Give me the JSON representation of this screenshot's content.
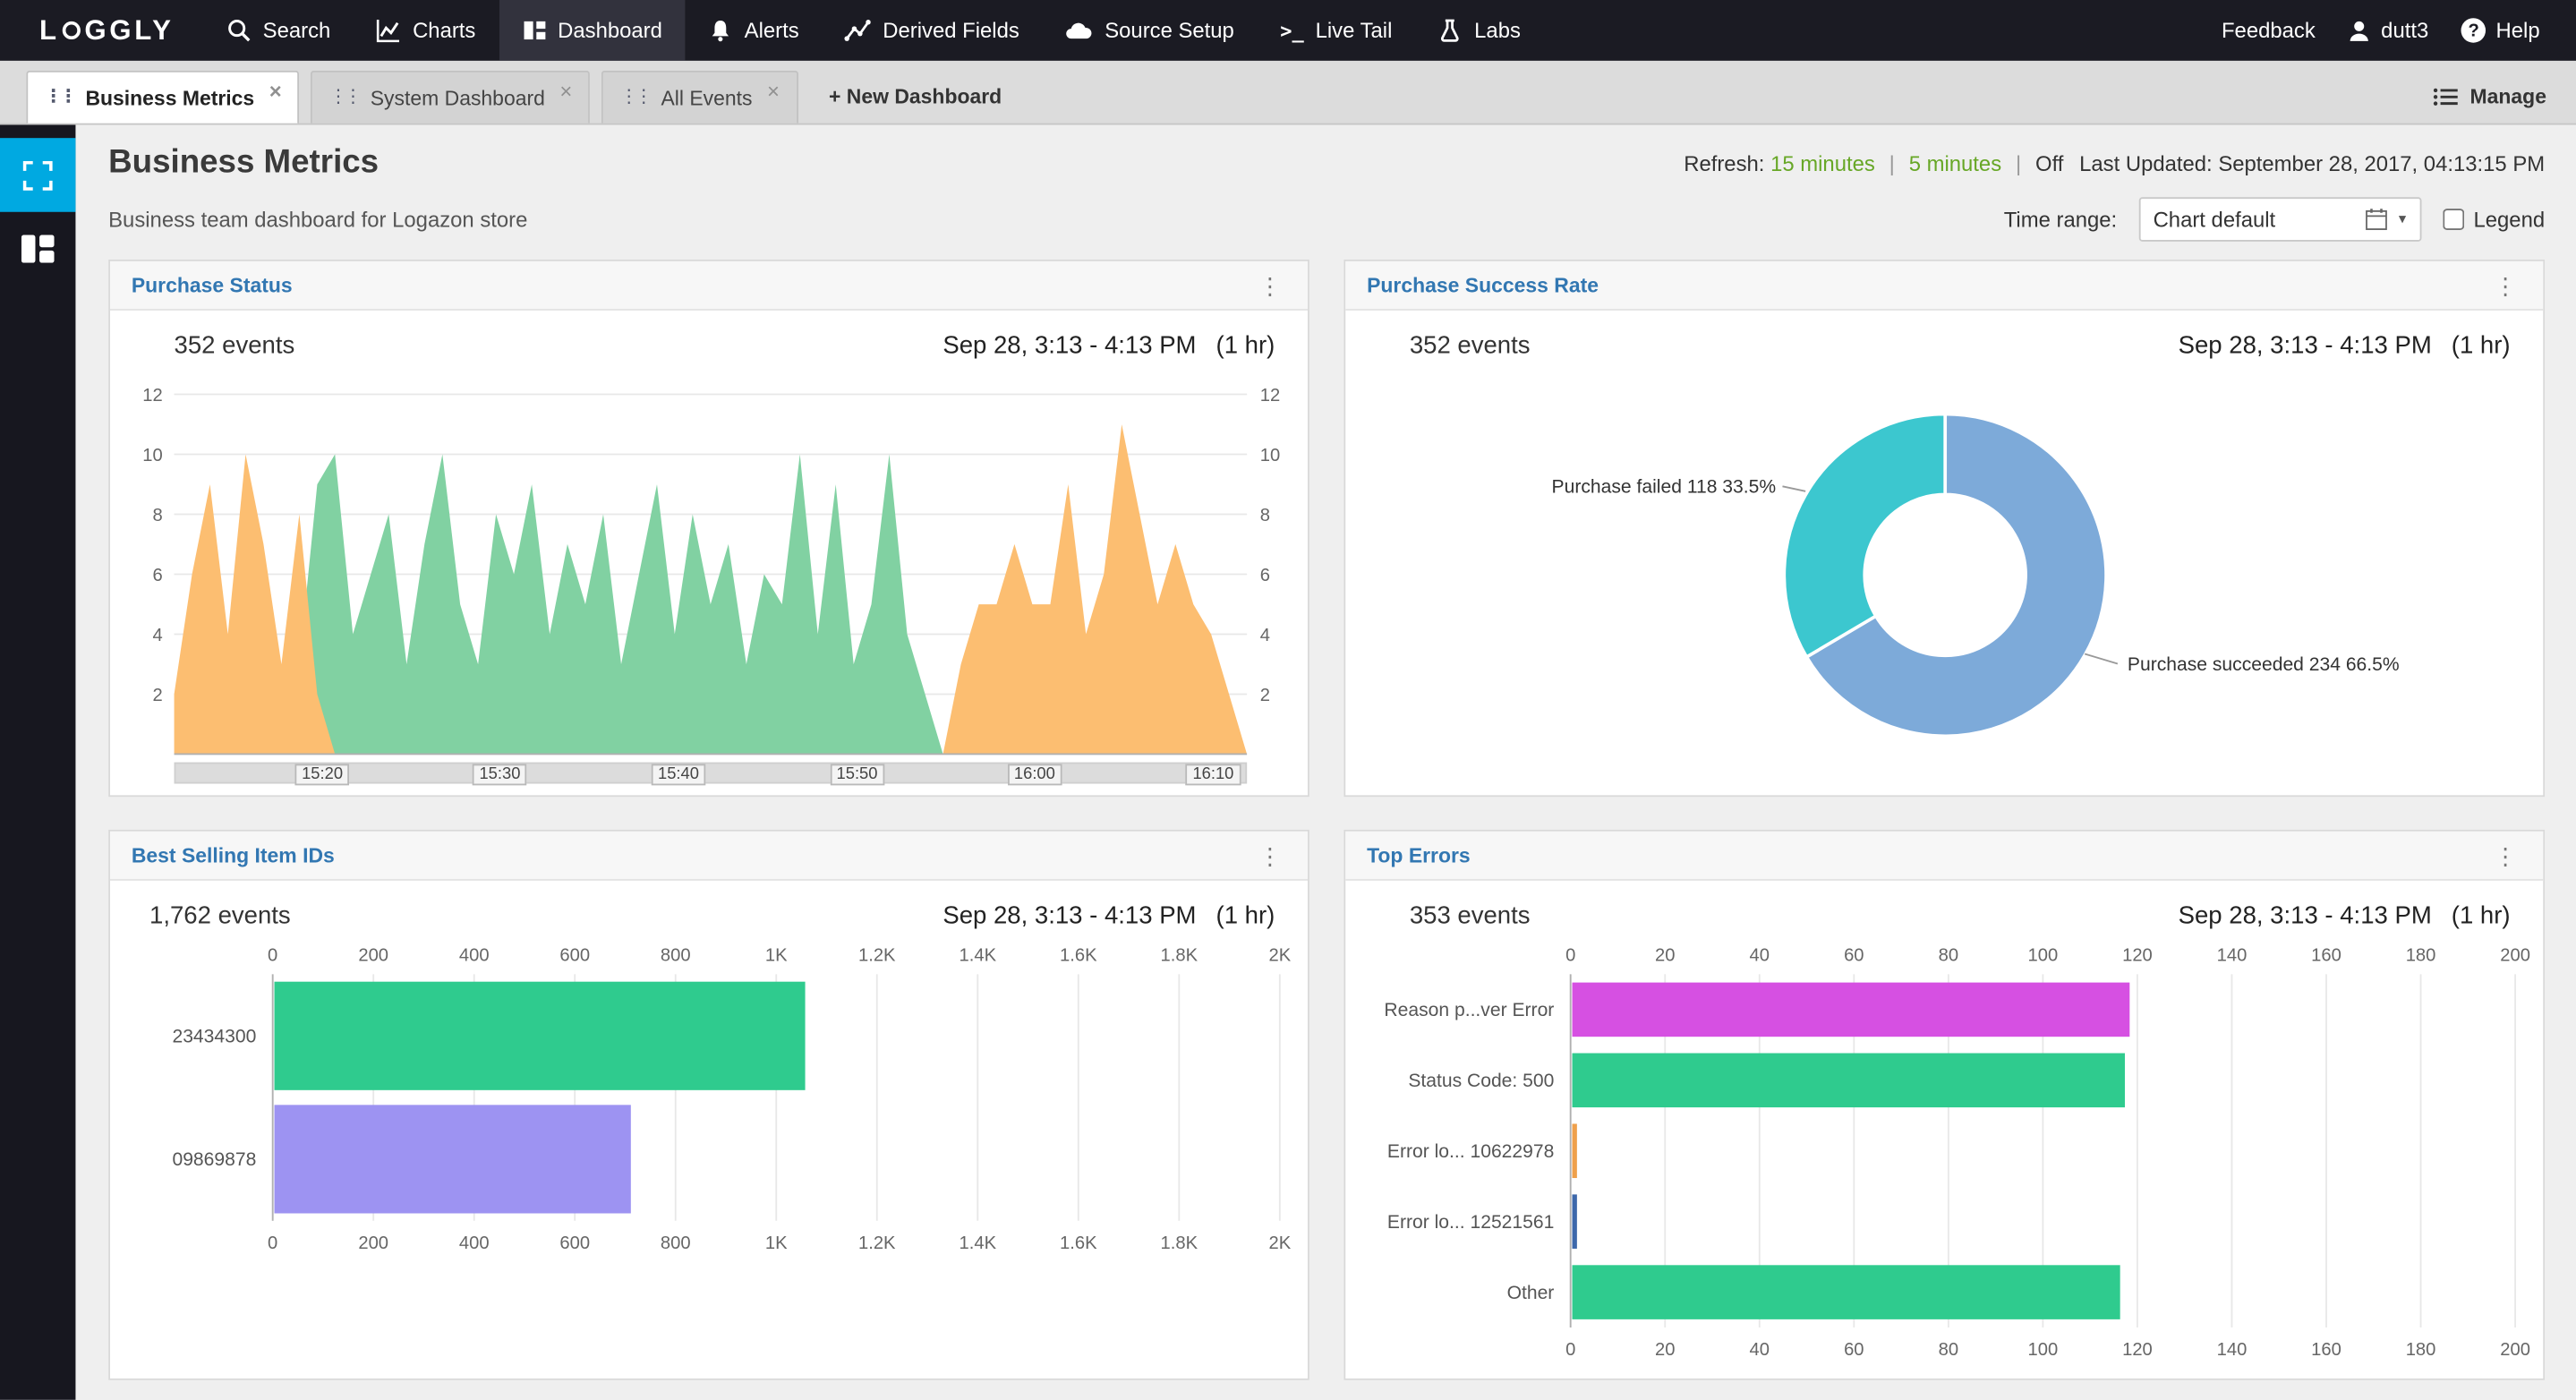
{
  "nav": {
    "logo": {
      "prefix": "L",
      "suffix": "GGLY",
      "full": "LOGGLY"
    },
    "items": [
      {
        "label": "Search"
      },
      {
        "label": "Charts"
      },
      {
        "label": "Dashboard",
        "active": true
      },
      {
        "label": "Alerts"
      },
      {
        "label": "Derived Fields"
      },
      {
        "label": "Source Setup"
      },
      {
        "label": "Live Tail"
      },
      {
        "label": "Labs"
      }
    ],
    "feedback": "Feedback",
    "user": "dutt3",
    "help": "Help"
  },
  "tabs": {
    "items": [
      {
        "label": "Business Metrics",
        "active": true
      },
      {
        "label": "System Dashboard",
        "active": false
      },
      {
        "label": "All Events",
        "active": false
      }
    ],
    "new_dashboard": "+ New Dashboard",
    "manage": "Manage"
  },
  "header": {
    "title": "Business Metrics",
    "subtitle": "Business team dashboard for Logazon store",
    "refresh_label": "Refresh:",
    "refresh_15": "15 minutes",
    "refresh_5": "5 minutes",
    "refresh_off": "Off",
    "sep": "|",
    "last_updated": "Last Updated: September 28, 2017, 04:13:15 PM",
    "time_range_label": "Time range:",
    "time_range_value": "Chart default",
    "legend_label": "Legend"
  },
  "icons": {
    "kebab": "⋮",
    "caret": "▾",
    "close": "×",
    "grip": "⋮⋮",
    "help_glyph": "?",
    "live_tail_glyph": ">_"
  },
  "panels": [
    {
      "title": "Purchase Status",
      "events": "352 events",
      "date": "Sep 28, 3:13 - 4:13 PM",
      "duration": "(1 hr)"
    },
    {
      "title": "Purchase Success Rate",
      "events": "352 events",
      "date": "Sep 28, 3:13 - 4:13 PM",
      "duration": "(1 hr)"
    },
    {
      "title": "Best Selling Item IDs",
      "events": "1,762 events",
      "date": "Sep 28, 3:13 - 4:13 PM",
      "duration": "(1 hr)"
    },
    {
      "title": "Top Errors",
      "events": "353 events",
      "date": "Sep 28, 3:13 - 4:13 PM",
      "duration": "(1 hr)"
    }
  ],
  "chart_data": [
    {
      "type": "area",
      "title": "Purchase Status",
      "events_total": 352,
      "ylim": [
        0,
        12
      ],
      "yticks": [
        2,
        4,
        6,
        8,
        10,
        12
      ],
      "xticks": [
        "15:20",
        "15:30",
        "15:40",
        "15:50",
        "16:00",
        "16:10"
      ],
      "xtick_pos": [
        0.137,
        0.303,
        0.47,
        0.637,
        0.803,
        0.97
      ],
      "x_range": "15:13 - 16:13",
      "series": [
        {
          "name": "purchase succeeded",
          "color": "#81d1a2",
          "values": [
            0,
            0,
            0,
            0,
            0,
            0,
            0,
            3,
            9,
            10,
            4,
            6,
            8,
            3,
            7,
            10,
            5,
            3,
            8,
            6,
            9,
            4,
            7,
            5,
            8,
            3,
            6,
            9,
            4,
            8,
            5,
            7,
            3,
            6,
            5,
            10,
            4,
            9,
            3,
            5,
            10,
            4,
            2,
            0,
            0,
            0,
            0,
            0,
            0,
            0,
            0,
            0,
            0,
            0,
            0,
            0,
            0,
            0,
            0,
            0,
            0
          ]
        },
        {
          "name": "purchase failed",
          "color": "#fcbe71",
          "values": [
            2,
            6,
            9,
            4,
            10,
            7,
            3,
            8,
            2,
            0,
            0,
            0,
            0,
            0,
            0,
            0,
            0,
            0,
            0,
            0,
            0,
            0,
            0,
            0,
            0,
            0,
            0,
            0,
            0,
            0,
            0,
            0,
            0,
            0,
            0,
            0,
            0,
            0,
            0,
            0,
            0,
            0,
            0,
            0,
            3,
            5,
            5,
            7,
            5,
            5,
            9,
            4,
            6,
            11,
            8,
            5,
            7,
            5,
            4,
            2,
            0
          ]
        }
      ]
    },
    {
      "type": "pie",
      "title": "Purchase Success Rate",
      "events_total": 352,
      "donut": true,
      "slices": [
        {
          "label": "Purchase succeeded",
          "value": 234,
          "pct": 66.5,
          "color": "#7daad9",
          "annotation": "Purchase succeeded 234 66.5%"
        },
        {
          "label": "Purchase failed",
          "value": 118,
          "pct": 33.5,
          "color": "#3cc7cf",
          "annotation": "Purchase failed 118 33.5%"
        }
      ]
    },
    {
      "type": "bar",
      "orientation": "horizontal",
      "title": "Best Selling Item IDs",
      "events_total": 1762,
      "categories": [
        "23434300",
        "09869878"
      ],
      "values": [
        1054,
        708
      ],
      "colors": [
        "#2fcb8e",
        "#9d93f2"
      ],
      "xlim": [
        0,
        2000
      ],
      "xticks": [
        "0",
        "200",
        "400",
        "600",
        "800",
        "1K",
        "1.2K",
        "1.4K",
        "1.6K",
        "1.8K",
        "2K"
      ]
    },
    {
      "type": "bar",
      "orientation": "horizontal",
      "title": "Top Errors",
      "events_total": 353,
      "categories": [
        "Reason p...ver Error",
        "Status Code: 500",
        "Error lo... 10622978",
        "Error lo... 12521561",
        "Other"
      ],
      "values": [
        118,
        117,
        1,
        1,
        116
      ],
      "colors": [
        "#d650e2",
        "#2fcb8e",
        "#efa04b",
        "#3d68ab",
        "#2fcb8e"
      ],
      "xlim": [
        0,
        200
      ],
      "xticks": [
        "0",
        "20",
        "40",
        "60",
        "80",
        "100",
        "120",
        "140",
        "160",
        "180",
        "200"
      ]
    }
  ]
}
